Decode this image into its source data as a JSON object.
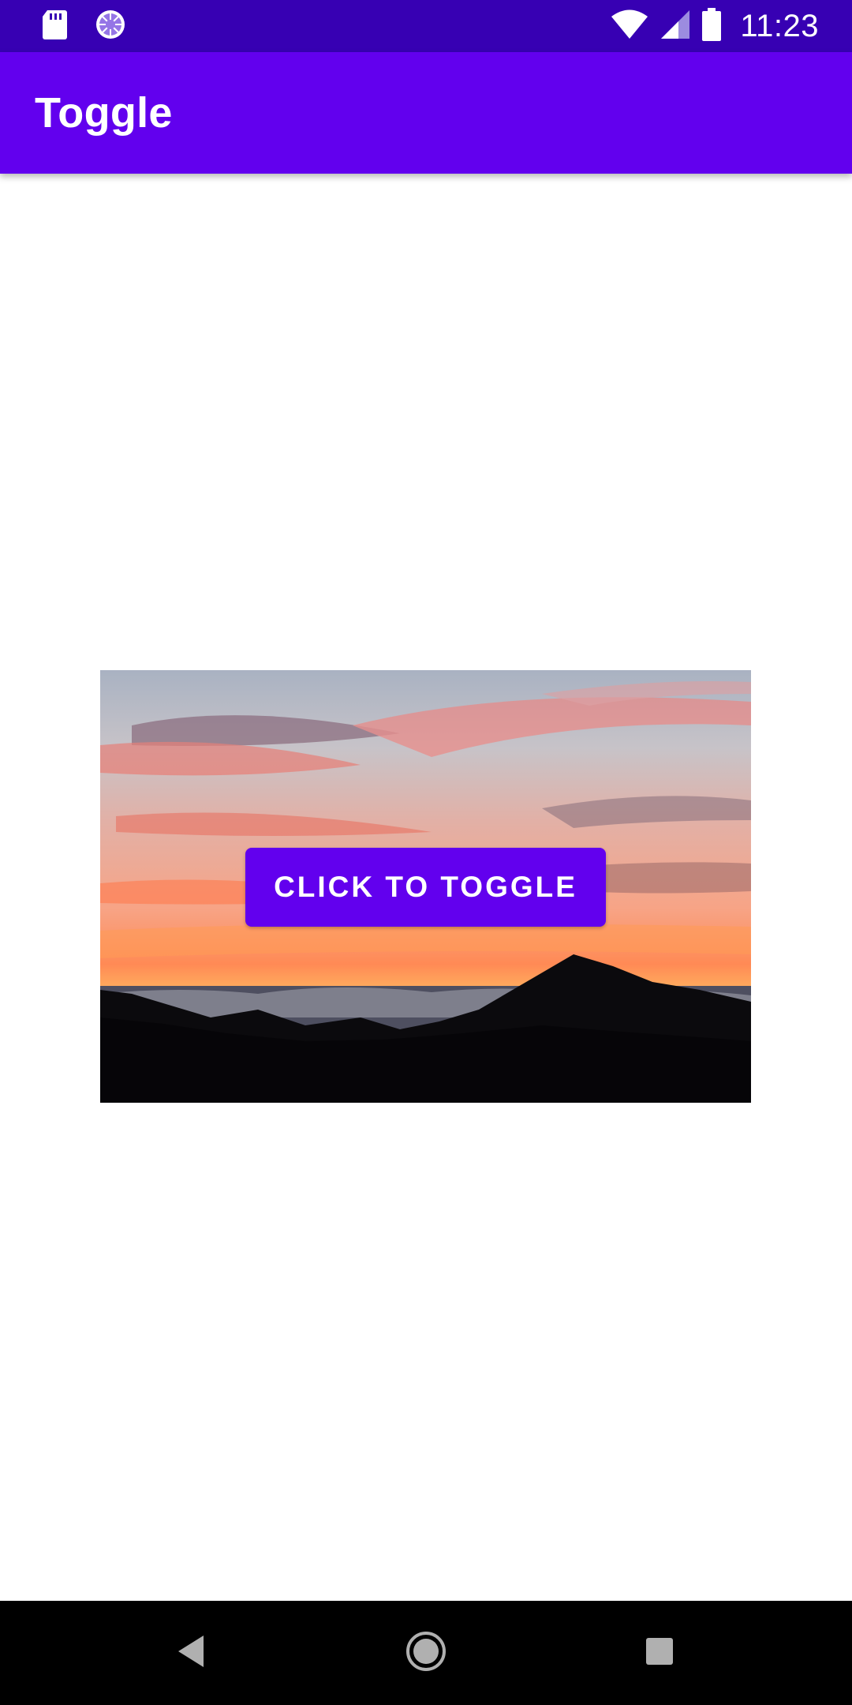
{
  "status_bar": {
    "time": "11:23",
    "icons": [
      "sd-card-icon",
      "sync-circle-icon",
      "wifi-icon",
      "cell-signal-icon",
      "battery-icon"
    ],
    "background_color": "#3700b3"
  },
  "app_bar": {
    "title": "Toggle",
    "background_color": "#6200ee"
  },
  "main": {
    "image": {
      "description_icon": "sunset-mountain-image"
    },
    "toggle_button": {
      "label": "CLICK TO TOGGLE",
      "color": "#6200ee"
    }
  },
  "nav_bar": {
    "icons": [
      "back-icon",
      "home-icon",
      "recents-icon"
    ]
  }
}
